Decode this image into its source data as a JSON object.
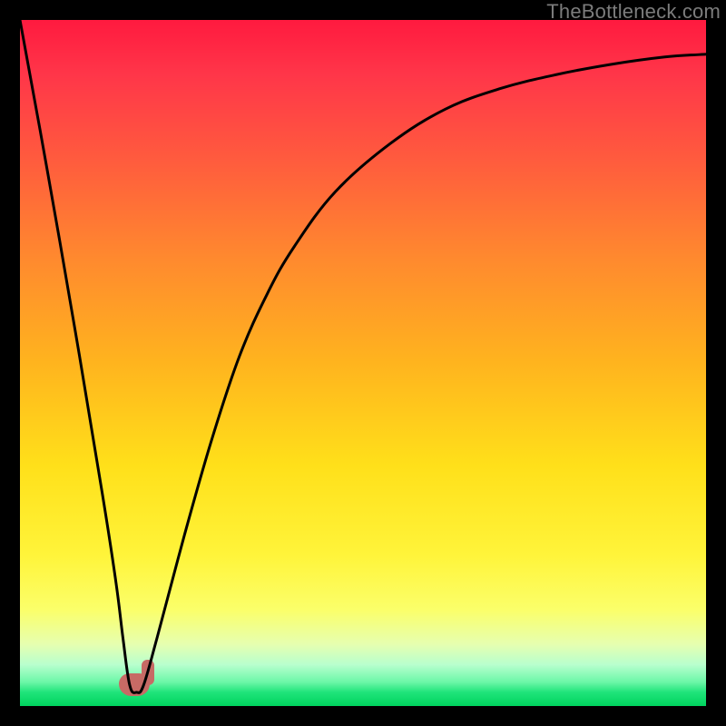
{
  "watermark": "TheBottleneck.com",
  "colors": {
    "frame": "#000000",
    "gradient_top": "#ff1a3f",
    "gradient_bottom": "#00d35e",
    "blob": "#c76a65",
    "curve": "#000000"
  },
  "chart_data": {
    "type": "line",
    "title": "",
    "xlabel": "",
    "ylabel": "",
    "xlim": [
      0,
      100
    ],
    "ylim": [
      0,
      100
    ],
    "grid": false,
    "legend": false,
    "series": [
      {
        "name": "curve",
        "x": [
          0,
          4,
          8,
          12,
          14,
          15,
          16,
          17,
          18,
          20,
          24,
          28,
          32,
          36,
          40,
          46,
          54,
          62,
          70,
          78,
          86,
          94,
          100
        ],
        "values": [
          100,
          78,
          55,
          31,
          18,
          10,
          3,
          2,
          3,
          10,
          25,
          39,
          51,
          60,
          67,
          75,
          82,
          87,
          90,
          92,
          93.5,
          94.6,
          95
        ]
      }
    ],
    "minimum_marker": {
      "x_range": [
        15,
        18
      ],
      "y": 2,
      "color": "#c76a65"
    }
  }
}
